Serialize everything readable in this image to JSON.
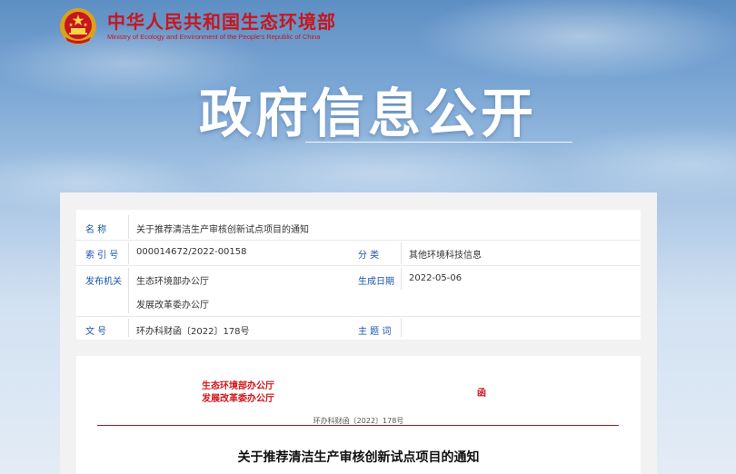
{
  "header": {
    "org_cn": "中华人民共和国生态环境部",
    "org_en": "Ministry of Ecology and Environment of the People's Republic of China"
  },
  "hero": {
    "title": "政府信息公开"
  },
  "meta": {
    "name_label": "名    称",
    "name_value": "关于推荐清洁生产审核创新试点项目的通知",
    "index_label": "索 引 号",
    "index_value": "000014672/2022-00158",
    "category_label": "分    类",
    "category_value": "其他环境科技信息",
    "issuer_label": "发布机关",
    "issuer_value_1": "生态环境部办公厅",
    "issuer_value_2": "发展改革委办公厅",
    "date_label": "生成日期",
    "date_value": "2022-05-06",
    "docno_label": "文    号",
    "docno_value": "环办科财函〔2022〕178号",
    "keywords_label": "主 题 词",
    "keywords_value": ""
  },
  "document": {
    "issuer_1": "生态环境部办公厅",
    "issuer_2": "发展改革委办公厅",
    "han": "函",
    "doc_number": "环办科财函〔2022〕178号",
    "title": "关于推荐清洁生产审核创新试点项目的通知"
  }
}
